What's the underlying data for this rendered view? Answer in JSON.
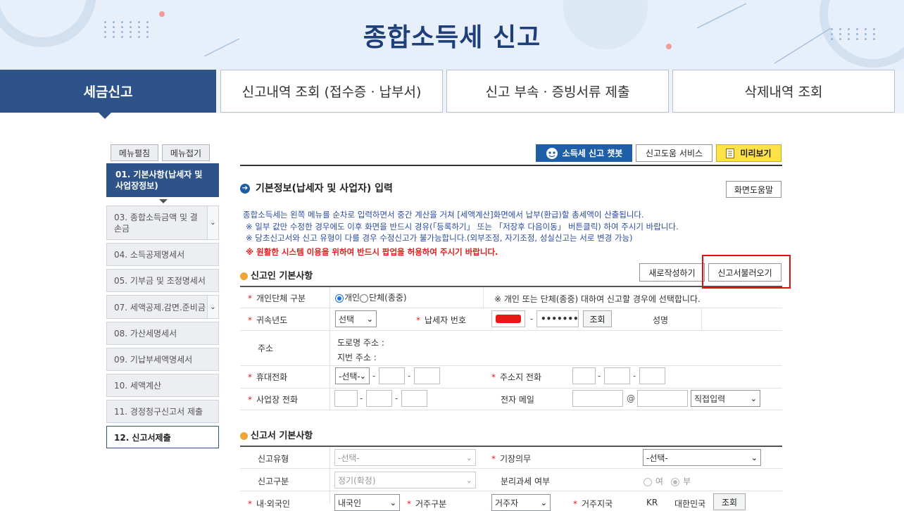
{
  "page_title": "종합소득세 신고",
  "tabs": [
    {
      "label": "세금신고"
    },
    {
      "label": "신고내역 조회 (접수증 · 납부서)"
    },
    {
      "label": "신고 부속 · 증빙서류 제출"
    },
    {
      "label": "삭제내역 조회"
    }
  ],
  "menu_buttons": {
    "expand": "메뉴펼침",
    "collapse": "메뉴접기"
  },
  "sidebar": {
    "items": [
      {
        "label": "01. 기본사항(납세자 및 사업장정보)"
      },
      {
        "label": "03. 종합소득금액 및 결손금"
      },
      {
        "label": "04. 소득공제명세서"
      },
      {
        "label": "05. 기부금 및 조정명세서"
      },
      {
        "label": "07. 세액공제.감면.준비금"
      },
      {
        "label": "08. 가산세명세서"
      },
      {
        "label": "09. 기납부세액명세서"
      },
      {
        "label": "10. 세액계산"
      },
      {
        "label": "11. 경정청구신고서 제출"
      },
      {
        "label": "12. 신고서제출"
      }
    ]
  },
  "toolbar": {
    "chatbot": "소득세 신고 챗봇",
    "help_service": "신고도움 서비스",
    "preview": "미리보기",
    "screen_help": "화면도움말"
  },
  "section_basic": {
    "title": "기본정보(납세자 및 사업자) 입력"
  },
  "info_lines": [
    "종합소득세는 왼쪽 메뉴를 순차로 입력하면서 중간 계산을 거쳐 [세액계산]화면에서 납부(환급)할 총세액이 산출됩니다.",
    "※ 일부 값만 수정한 경우에도 이후 화면을 반드시 경유(「등록하기」 또는 「저장후 다음이동」 버튼클릭) 하여 주시기 바랍니다.",
    "※ 당초신고서와 신고 유형이 다를 경우 수정신고가 불가능합니다.(외부조정, 자기조정, 성실신고는 서로 변경 가능)"
  ],
  "popup_notice": "※ 원활한 시스템 이용을 위하여 반드시 팝업을 허용하여 주시기 바랍니다.",
  "reporter": {
    "title": "신고인 기본사항",
    "new_button": "새로작성하기",
    "load_button": "신고서불러오기",
    "type_label": "개인단체 구분",
    "type_options": [
      "개인",
      "단체(종중)"
    ],
    "type_selected": "개인",
    "type_hint": "※ 개인 또는 단체(종중) 대하여 신고할 경우에 선택합니다.",
    "year_label": "귀속년도",
    "year_value": "선택",
    "taxpayer_no_label": "납세자 번호",
    "taxpayer_no_back": "•••••••",
    "lookup_button": "조회",
    "name_label": "성명",
    "address_label": "주소",
    "road_address_label": "도로명 주소 :",
    "lot_address_label": "지번 주소 :",
    "mobile_label": "휴대전화",
    "mobile_prefix": "-선택-",
    "home_phone_label": "주소지 전화",
    "business_phone_label": "사업장 전화",
    "email_label": "전자 메일",
    "email_at": "@",
    "email_domain": "직접입력"
  },
  "report": {
    "title": "신고서 기본사항",
    "report_type_label": "신고유형",
    "report_type_value": "-선택-",
    "bookkeeping_label": "기장의무",
    "bookkeeping_value": "-선택-",
    "report_class_label": "신고구분",
    "report_class_value": "정기(확정)",
    "separate_tax_label": "분리과세 여부",
    "separate_options": [
      "여",
      "부"
    ],
    "separate_selected": "부",
    "nationality_label": "내·외국인",
    "nationality_value": "내국인",
    "residence_class_label": "거주구분",
    "residence_class_value": "거주자",
    "residence_country_label": "거주지국",
    "country_code": "KR",
    "country_name": "대한민국",
    "country_lookup": "조회"
  }
}
